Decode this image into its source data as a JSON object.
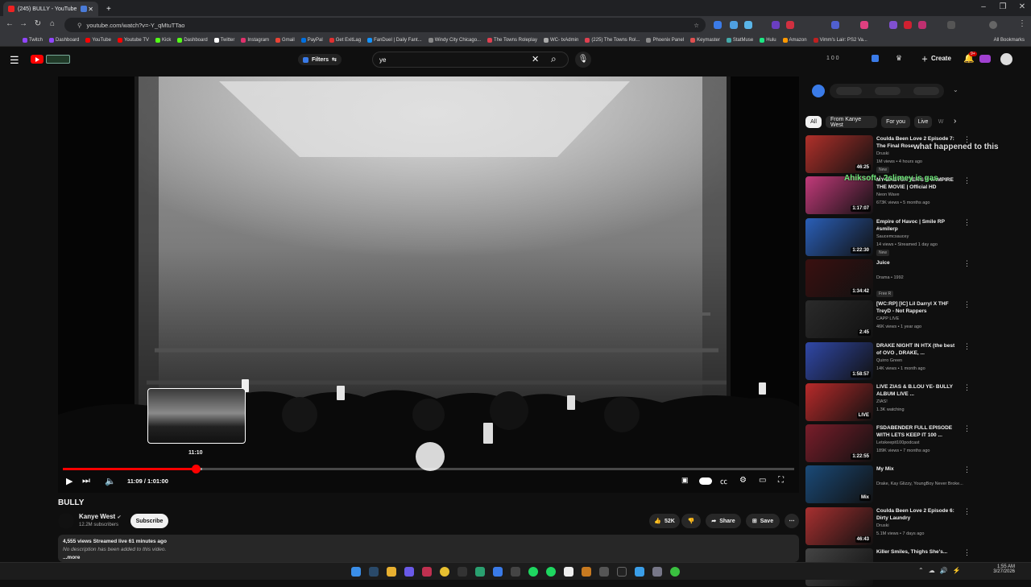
{
  "browser": {
    "tabs": [
      {
        "label": "(245) BULLY - YouTube",
        "active": true
      },
      {
        "label": "",
        "active": false
      }
    ],
    "new_tab": "+",
    "window_controls": [
      "–",
      "❐",
      "✕"
    ],
    "url": "youtube.com/watch?v=-Y_qMtuTTao",
    "bookmarks": [
      "Twitch",
      "Dashboard",
      "YouTube",
      "Youtube TV",
      "Kick",
      "Dashboard",
      "Twitter",
      "Instagram",
      "Gmail",
      "PayPal",
      "Get ExitLag",
      "FanDuel | Daily Fant...",
      "Windy City Chicago...",
      "The Towns Roleplay",
      "WC- txAdmin",
      "(225) The Towns Rol...",
      "Phoenix Panel",
      "Keymaster",
      "StatMuse",
      "Hulu",
      "Amazon",
      "Vimm's Lair: PS2 Va..."
    ],
    "all_bookmarks": "All Bookmarks"
  },
  "youtube": {
    "filters_label": "Filters",
    "search_value": "ye",
    "header_counters": "1  0  0",
    "create_label": "Create",
    "notif_count": "9+"
  },
  "player": {
    "current_time": "11:09",
    "duration": "1:01:00",
    "preview_time": "11:10",
    "progress_fraction": 0.182,
    "buffer_fraction": 0.19
  },
  "video": {
    "title": "BULLY",
    "channel": "Kanye West",
    "verified": "✔",
    "subscribers": "12.2M subscribers",
    "subscribe_label": "Subscribe",
    "likes": "52K",
    "share_label": "Share",
    "save_label": "Save",
    "views_line": "4,555 views  Streamed live 61 minutes ago",
    "description": "No description has been added to this video.",
    "more_label": "...more"
  },
  "sidebar": {
    "chips": [
      "All",
      "From Kanye West",
      "For you",
      "Live",
      "W"
    ],
    "overlay_lines": [
      "what happened to this",
      "Ahiksoft : 2slimey is gas"
    ],
    "recommendations": [
      {
        "title": "Coulda Been Love 2 Episode 7: The Final Rose",
        "channel": "Druski",
        "meta": "1M views • 4 hours ago",
        "badge": "New",
        "duration": "46:25",
        "color": "#b0302a"
      },
      {
        "title": "MY BABYSITTER'S A VAMPIRE THE MOVIE | Official HD",
        "channel": "Neon Wave",
        "meta": "673K views • 5 months ago",
        "badge": "",
        "duration": "1:17:07",
        "color": "#c23a7a"
      },
      {
        "title": "Empire of Havoc | Smile RP #smilerp",
        "channel": "Saucemcsaucey",
        "meta": "14 views • Streamed 1 day ago",
        "badge": "New",
        "duration": "1:22:30",
        "color": "#2a5fb8"
      },
      {
        "title": "Juice",
        "channel": "Drama • 1992",
        "meta": "",
        "badge": "Free  R",
        "duration": "1:34:42",
        "color": "#3a1010"
      },
      {
        "title": "[WC:RP] [IC] Lil Darryl X THF TreyD - Not Rappers",
        "channel": "CAPP LIVE",
        "meta": "46K views • 1 year ago",
        "badge": "",
        "duration": "2:45",
        "color": "#2b2b2b"
      },
      {
        "title": "DRAKE NIGHT IN HTX (the best of OVO , DRAKE, ...",
        "channel": "Quirro Green",
        "meta": "14K views • 1 month ago",
        "badge": "",
        "duration": "1:58:57",
        "color": "#3048a8"
      },
      {
        "title": "LIVE ZIAS & B.LOU YE- BULLY ALBUM LIVE ...",
        "channel": "ZIAS!",
        "meta": "1.3K watching",
        "badge": "",
        "duration": "LIVE",
        "color": "#b82a2a"
      },
      {
        "title": "FSDABENDER FULL EPISODE WITH LETS KEEP IT 100 ...",
        "channel": "Letskeepit100podcast",
        "meta": "189K views • 7 months ago",
        "badge": "",
        "duration": "1:22:55",
        "color": "#7a1d2a"
      },
      {
        "title": "My Mix",
        "channel": "Drake, Kay Glizzy, YoungBoy Never Broke...",
        "meta": "",
        "badge": "",
        "duration": "Mix",
        "color": "#1a4a78"
      },
      {
        "title": "Coulda Been Love 2 Episode 6: Dirty Laundry",
        "channel": "Druski",
        "meta": "5.1M views • 7 days ago",
        "badge": "",
        "duration": "46:43",
        "color": "#a83030"
      },
      {
        "title": "Killer Smiles, Thighs She's...",
        "channel": "",
        "meta": "",
        "badge": "",
        "duration": "",
        "color": "#444"
      }
    ]
  },
  "taskbar": {
    "time": "1:55 AM",
    "date": "3/27/2026"
  }
}
